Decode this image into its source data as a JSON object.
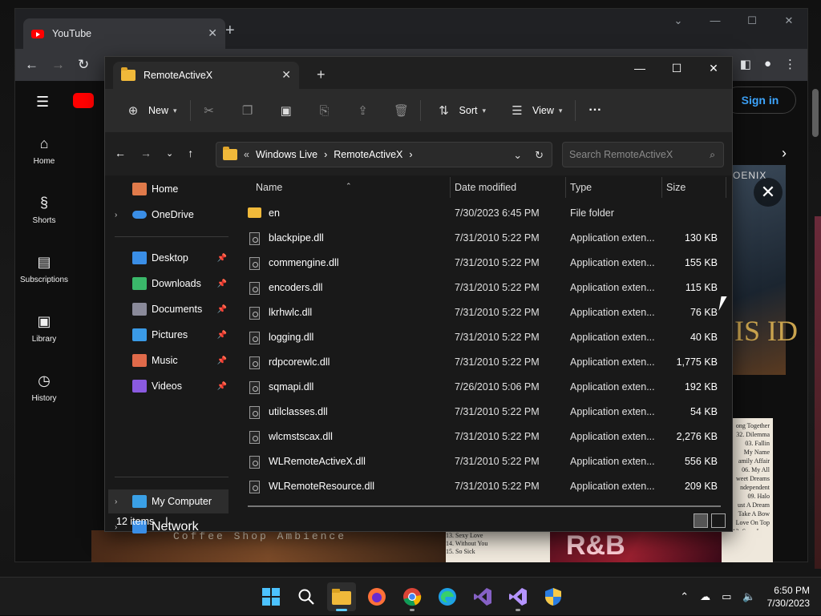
{
  "browser": {
    "tab_title": "YouTube",
    "new_tab": "+",
    "sidebar": [
      {
        "label": "Home",
        "icon": "home-icon"
      },
      {
        "label": "Shorts",
        "icon": "shorts-icon"
      },
      {
        "label": "Subscriptions",
        "icon": "subscriptions-icon"
      },
      {
        "label": "Library",
        "icon": "library-icon"
      },
      {
        "label": "History",
        "icon": "history-icon"
      }
    ],
    "sign_in": "Sign in",
    "thumb_title": "OENIX",
    "thumb_gold": "IS ID",
    "tracklist_right": [
      "ong Together",
      "32. Dilemma",
      "03. Fallin",
      "My Name",
      "amily Affair",
      "06. My All",
      "weet Dreams",
      "ndependent",
      "09. Halo",
      "ust A Dream",
      "Take A Bow",
      "Love On Top",
      "13. Sexy Love",
      "14. Without You",
      "15. So Sick"
    ],
    "bottom_banner": "Coffee Shop Ambience",
    "bottom_tracklist": [
      "13. Sexy Love",
      "14. Without You",
      "15. So Sick"
    ],
    "bottom_rb": "R&B"
  },
  "explorer": {
    "tab_title": "RemoteActiveX",
    "new_tab": "+",
    "toolbar": {
      "new_label": "New",
      "sort_label": "Sort",
      "view_label": "View",
      "more_label": "···"
    },
    "breadcrumb": {
      "prefix": "«",
      "parent": "Windows Live",
      "current": "RemoteActiveX",
      "sep": "›"
    },
    "search_placeholder": "Search RemoteActiveX",
    "nav": {
      "home": "Home",
      "onedrive": "OneDrive",
      "quick": [
        {
          "label": "Desktop",
          "color": "#3a8ee6"
        },
        {
          "label": "Downloads",
          "color": "#3ab86a"
        },
        {
          "label": "Documents",
          "color": "#8a8a9a"
        },
        {
          "label": "Pictures",
          "color": "#3a9ae6"
        },
        {
          "label": "Music",
          "color": "#e06a4a"
        },
        {
          "label": "Videos",
          "color": "#8a5ae0"
        }
      ],
      "my_computer": "My Computer",
      "network": "Network"
    },
    "columns": {
      "name": "Name",
      "date": "Date modified",
      "type": "Type",
      "size": "Size"
    },
    "files": [
      {
        "name": "en",
        "date": "7/30/2023 6:45 PM",
        "type": "File folder",
        "size": "",
        "folder": true
      },
      {
        "name": "blackpipe.dll",
        "date": "7/31/2010 5:22 PM",
        "type": "Application exten...",
        "size": "130 KB"
      },
      {
        "name": "commengine.dll",
        "date": "7/31/2010 5:22 PM",
        "type": "Application exten...",
        "size": "155 KB"
      },
      {
        "name": "encoders.dll",
        "date": "7/31/2010 5:22 PM",
        "type": "Application exten...",
        "size": "115 KB"
      },
      {
        "name": "lkrhwlc.dll",
        "date": "7/31/2010 5:22 PM",
        "type": "Application exten...",
        "size": "76 KB"
      },
      {
        "name": "logging.dll",
        "date": "7/31/2010 5:22 PM",
        "type": "Application exten...",
        "size": "40 KB"
      },
      {
        "name": "rdpcorewlc.dll",
        "date": "7/31/2010 5:22 PM",
        "type": "Application exten...",
        "size": "1,775 KB"
      },
      {
        "name": "sqmapi.dll",
        "date": "7/26/2010 5:06 PM",
        "type": "Application exten...",
        "size": "192 KB"
      },
      {
        "name": "utilclasses.dll",
        "date": "7/31/2010 5:22 PM",
        "type": "Application exten...",
        "size": "54 KB"
      },
      {
        "name": "wlcmstscax.dll",
        "date": "7/31/2010 5:22 PM",
        "type": "Application exten...",
        "size": "2,276 KB"
      },
      {
        "name": "WLRemoteActiveX.dll",
        "date": "7/31/2010 5:22 PM",
        "type": "Application exten...",
        "size": "556 KB"
      },
      {
        "name": "WLRemoteResource.dll",
        "date": "7/31/2010 5:22 PM",
        "type": "Application exten...",
        "size": "209 KB"
      }
    ],
    "status": "12 items",
    "status_sep": "|"
  },
  "taskbar": {
    "apps": [
      "start-icon",
      "search-icon",
      "file-explorer-icon",
      "firefox-icon",
      "chrome-icon",
      "edge-icon",
      "visual-studio-icon",
      "visual-studio-preview-icon",
      "security-icon"
    ],
    "time": "6:50 PM",
    "date": "7/30/2023"
  }
}
